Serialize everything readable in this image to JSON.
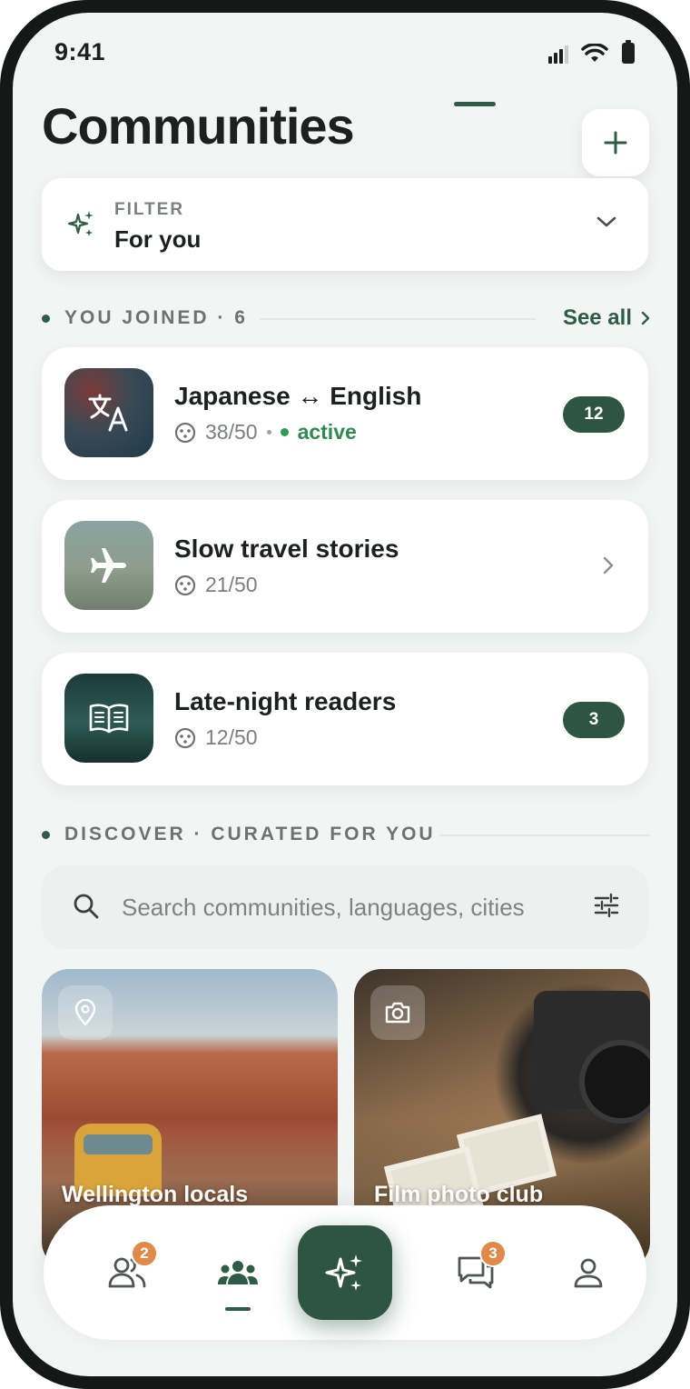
{
  "status_bar": {
    "time": "9:41"
  },
  "header": {
    "title": "Communities"
  },
  "filter": {
    "label": "FILTER",
    "value": "For you"
  },
  "joined": {
    "heading": "YOU JOINED · 6",
    "see_all": "See all",
    "items": [
      {
        "name": "Japanese ↔ English",
        "members": "38/50",
        "status": "active",
        "unread": "12"
      },
      {
        "name": "Slow travel stories",
        "members": "21/50"
      },
      {
        "name": "Late-night readers",
        "members": "12/50",
        "unread": "3"
      }
    ]
  },
  "discover": {
    "heading": "DISCOVER · CURATED FOR YOU",
    "search_placeholder": "Search communities, languages, cities",
    "cards": [
      {
        "title": "Wellington locals",
        "icon": "location-pin-icon"
      },
      {
        "title": "Film photo club",
        "icon": "camera-icon"
      }
    ]
  },
  "bottom_nav": {
    "items": [
      {
        "name": "friends",
        "badge": "2"
      },
      {
        "name": "communities"
      },
      {
        "name": "sparkle"
      },
      {
        "name": "messages",
        "badge": "3"
      },
      {
        "name": "profile"
      }
    ]
  },
  "colors": {
    "accent": "#2e5c47",
    "badge": "#e08a4a",
    "active": "#2f9a58"
  }
}
